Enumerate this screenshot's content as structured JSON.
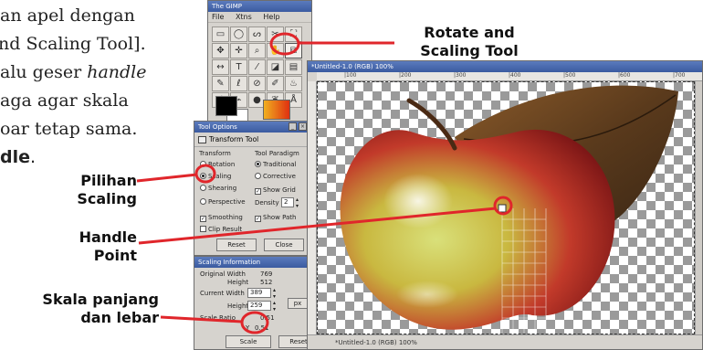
{
  "paragraph": {
    "line1": "an apel dengan",
    "line2": "nd Scaling Tool].",
    "line3_prefix": "alu geser ",
    "line3_italic": "handle",
    "line4": "aga agar skala",
    "line5": "oar tetap sama.",
    "line6_bold": "dle",
    "line6_end": "."
  },
  "callouts": {
    "rotate_line1": "Rotate and",
    "rotate_line2": "Scaling Tool",
    "pilihan_line1": "Pilihan",
    "pilihan_line2": "Scaling",
    "handle_line1": "Handle",
    "handle_line2": "Point",
    "skala_line1": "Skala panjang",
    "skala_line2": "dan lebar"
  },
  "toolbox": {
    "title": "The GIMP",
    "menu": [
      "File",
      "Xtns",
      "Help"
    ],
    "tools": [
      "▭",
      "◯",
      "ᔕ",
      "✂",
      "⛶",
      "✥",
      "✛",
      "⌕",
      "✋",
      "⧉",
      "↔",
      "T",
      "⁄",
      "◪",
      "▤",
      "✎",
      "ℓ",
      "⊘",
      "✐",
      "♨",
      "∕",
      "⌁",
      "●",
      "❦",
      "Å"
    ],
    "selected_tool_index": 9
  },
  "tool_options": {
    "window_title": "Tool Options",
    "header": "Transform Tool",
    "transform_label": "Transform",
    "transform_options": [
      "Rotation",
      "Scaling",
      "Shearing",
      "Perspective"
    ],
    "transform_selected": "Scaling",
    "paradigm_label": "Tool Paradigm",
    "paradigm_options": [
      "Traditional",
      "Corrective"
    ],
    "paradigm_selected": "Traditional",
    "show_grid": "Show Grid",
    "density_label": "Density",
    "density_value": "2",
    "smoothing": "Smoothing",
    "show_path": "Show Path",
    "clip_result": "Clip Result",
    "reset": "Reset",
    "close": "Close"
  },
  "scaling_info": {
    "window_title": "Scaling Information",
    "original_width_label": "Original Width",
    "original_width_value": "769",
    "height_label": "Height",
    "original_height_value": "512",
    "current_width_label": "Current Width",
    "current_width_value": "389",
    "current_height_value": "259",
    "unit": "px",
    "scale_ratio_label": "Scale Ratio",
    "scale_ratio_x": "0.51",
    "scale_ratio_y_label": "Y",
    "scale_ratio_y": "0.51",
    "scale_button": "Scale",
    "reset_button": "Reset"
  },
  "image_window": {
    "title": "*Untitled-1.0 (RGB) 100%",
    "ruler_ticks": [
      "|100",
      "|200",
      "|300",
      "|400",
      "|500",
      "|600",
      "|700"
    ],
    "status": "*Untitled-1.0 (RGB) 100%"
  },
  "colors": {
    "callout_red": "#e0262b"
  }
}
